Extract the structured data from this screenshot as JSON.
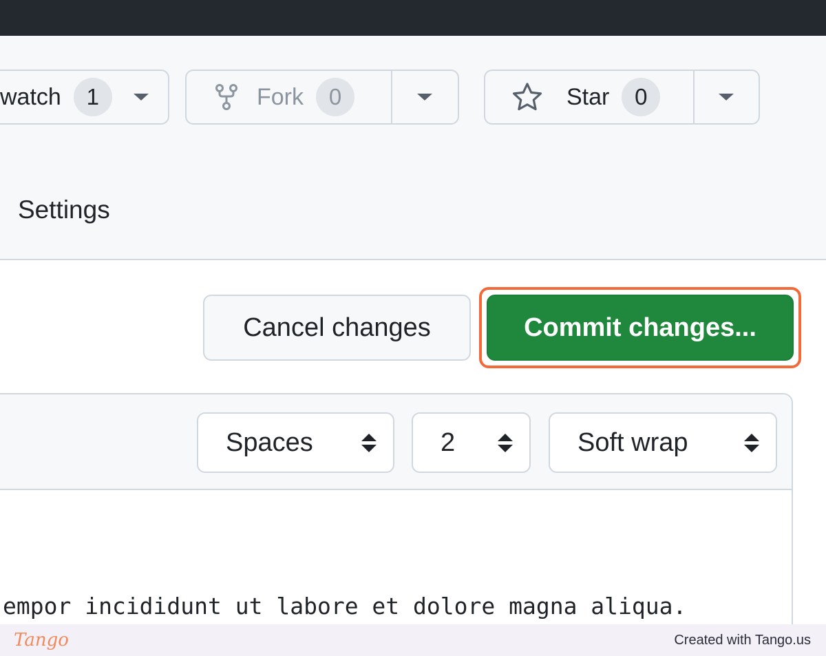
{
  "header": {
    "watch": {
      "label": "watch",
      "count": "1"
    },
    "fork": {
      "label": "Fork",
      "count": "0"
    },
    "star": {
      "label": "Star",
      "count": "0"
    },
    "nav": {
      "settings_label": "Settings"
    }
  },
  "actions": {
    "cancel_label": "Cancel changes",
    "commit_label": "Commit changes...",
    "highlight_color": "#f26a39",
    "commit_color": "#1f883d"
  },
  "editor": {
    "indent_mode": "Spaces",
    "indent_size": "2",
    "wrap_mode": "Soft wrap",
    "code_line": "empor incididunt ut labore et dolore magna aliqua."
  },
  "footer": {
    "logo": "Tango",
    "credit": "Created with Tango.us"
  },
  "icons": {
    "fork": "repo-forked-icon",
    "star": "star-icon",
    "dropdown": "triangle-down-icon",
    "select": "sort-arrows-icon"
  }
}
